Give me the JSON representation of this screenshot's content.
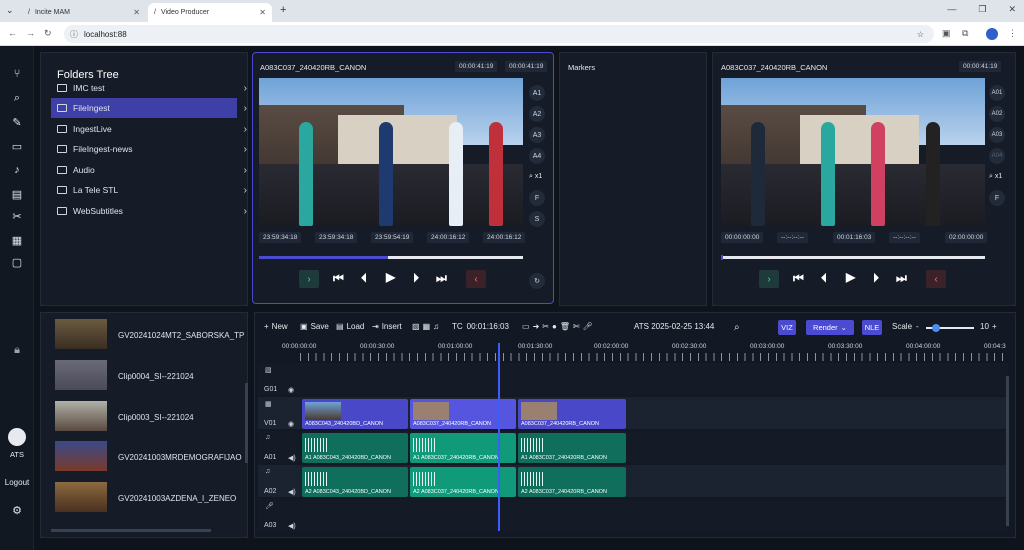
{
  "browser": {
    "tabs": [
      {
        "title": "Incite MAM"
      },
      {
        "title": "Video Producer"
      }
    ],
    "url": "localhost:88"
  },
  "sidebar": {
    "user": "ATS",
    "logout": "Logout"
  },
  "folders": {
    "title": "Folders Tree",
    "items": [
      "IMC test",
      "FileIngest",
      "IngestLive",
      "FileIngest-news",
      "Audio",
      "La Tele STL",
      "WebSubtitles"
    ],
    "selected": "FileIngest"
  },
  "source": {
    "title": "A083C037_240420RB_CANON",
    "dur1": "00:00:41:19",
    "dur2": "00:00:41:19",
    "tcs": [
      "23:59:34:18",
      "23:59:34:18",
      "23:59:54:19",
      "24:00:16:12",
      "24:00:16:12"
    ],
    "progress": 0.49,
    "side": [
      "A1",
      "A2",
      "A3",
      "A4",
      "x1",
      "F",
      "S"
    ]
  },
  "markers": {
    "title": "Markers"
  },
  "program": {
    "title": "A083C037_240420RB_CANON",
    "dur": "00:00:41:19",
    "tcs": [
      "00:00:00:00",
      "--:--:--:--",
      "00:01:16:03",
      "--:--:--:--",
      "02:00:00:00"
    ],
    "side": [
      "A01",
      "A02",
      "A03",
      "A04",
      "x1",
      "F"
    ]
  },
  "clips": [
    "GV20241024MT2_SABORSKA_TP",
    "Clip0004_SI--221024",
    "Clip0003_SI--221024",
    "GV20241003MRDEMOGRAFIJAO",
    "GV20241003AZDENA_I_ZENEO"
  ],
  "toolbar": {
    "new": "New",
    "save": "Save",
    "load": "Load",
    "insert": "Insert",
    "tc_label": "TC",
    "tc": "00:01:16:03",
    "stamp": "ATS 2025-02-25 13:44",
    "viz": "VIZ",
    "render": "Render",
    "nle": "NLE",
    "scale": "Scale",
    "scale_val": "10"
  },
  "ruler": [
    "00:00:00:00",
    "00:00:30:00",
    "00:01:00:00",
    "00:01:30:00",
    "00:02:00:00",
    "00:02:30:00",
    "00:03:00:00",
    "00:03:30:00",
    "00:04:00:00",
    "00:04:3"
  ],
  "tracks": [
    "G01",
    "V01",
    "A01",
    "A02",
    "A03"
  ],
  "video_clips": [
    "A083C043_240420BD_CANON",
    "A083C037_240420RB_CANON",
    "A083C037_240420RB_CANON"
  ],
  "a1_clips": [
    "A1 A083C043_240420BD_CANON",
    "A1 A083C037_240420RB_CANON",
    "A1 A083C037_240420RB_CANON"
  ],
  "a2_clips": [
    "A2 A083C043_240420BD_CANON",
    "A2 A083C037_240420RB_CANON",
    "A2 A083C037_240420RB_CANON"
  ],
  "colors": {
    "accent": "#4b4bd2",
    "audio": "#0f8f73",
    "video": "#4848c8"
  }
}
